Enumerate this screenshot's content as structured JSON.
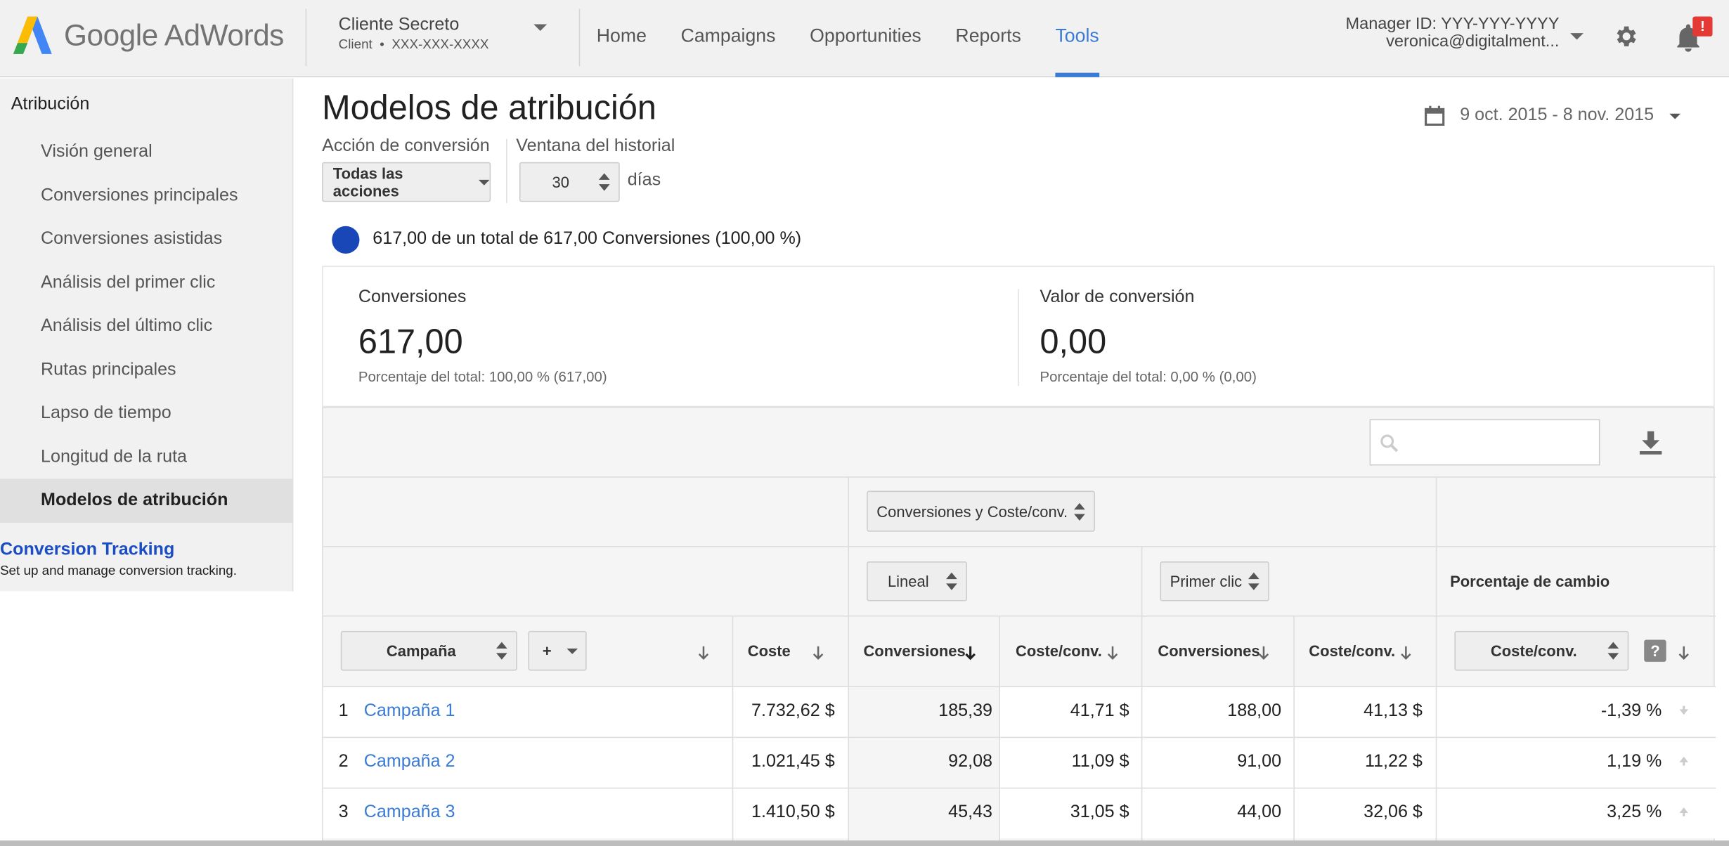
{
  "header": {
    "brand_google": "Google",
    "brand_adwords": "AdWords",
    "account_name": "Cliente Secreto",
    "account_type": "Client",
    "account_id": "XXX-XXX-XXXX",
    "nav": [
      "Home",
      "Campaigns",
      "Opportunities",
      "Reports",
      "Tools"
    ],
    "nav_active": "Tools",
    "manager_id": "Manager ID: YYY-YYY-YYYY",
    "user_email": "veronica@digitalment...",
    "notification_badge": "!",
    "icons": [
      "settings-gear-icon",
      "notification-bell-icon"
    ]
  },
  "sidebar": {
    "title": "Atribución",
    "items": [
      {
        "label": "Visión general"
      },
      {
        "label": "Conversiones principales"
      },
      {
        "label": "Conversiones asistidas"
      },
      {
        "label": "Análisis del primer clic"
      },
      {
        "label": "Análisis del último clic"
      },
      {
        "label": "Rutas principales"
      },
      {
        "label": "Lapso de tiempo"
      },
      {
        "label": "Longitud de la ruta"
      },
      {
        "label": "Modelos de atribución",
        "selected": true
      }
    ],
    "link_title": "Conversion Tracking",
    "link_desc": "Set up and manage conversion tracking."
  },
  "main": {
    "title": "Modelos de atribución",
    "date_range": "9 oct. 2015 - 8 nov. 2015",
    "conversion_action_label": "Acción de conversión",
    "conversion_action_value": "Todas las acciones",
    "window_label": "Ventana del historial",
    "window_value": "30",
    "window_unit": "días",
    "total_text": "617,00 de un total de 617,00 Conversiones (100,00 %)",
    "total_color": "#1a47b8"
  },
  "summary": {
    "conversions_label": "Conversiones",
    "conversions_value": "617,00",
    "conversions_sub": "Porcentaje del total: 100,00 % (617,00)",
    "value_label": "Valor de conversión",
    "value_value": "0,00",
    "value_sub": "Porcentaje del total: 0,00 % (0,00)"
  },
  "table": {
    "metric_select": "Conversiones y Coste/conv.",
    "model_a": "Lineal",
    "model_b": "Primer clic",
    "change_header": "Porcentaje de cambio",
    "campaign_select": "Campaña",
    "add_button": "+",
    "columns": {
      "cost": "Coste",
      "a_conv": "Conversiones",
      "a_cpc": "Coste/conv.",
      "b_conv": "Conversiones",
      "b_cpc": "Coste/conv.",
      "change_select": "Coste/conv.",
      "help": "?"
    },
    "rows": [
      {
        "n": "1",
        "campaign": "Campaña 1",
        "cost": "7.732,62 $",
        "a_conv": "185,39",
        "a_cpc": "41,71 $",
        "b_conv": "188,00",
        "b_cpc": "41,13 $",
        "change": "-1,39 %",
        "trend": "down"
      },
      {
        "n": "2",
        "campaign": "Campaña 2",
        "cost": "1.021,45 $",
        "a_conv": "92,08",
        "a_cpc": "11,09 $",
        "b_conv": "91,00",
        "b_cpc": "11,22 $",
        "change": "1,19 %",
        "trend": "up"
      },
      {
        "n": "3",
        "campaign": "Campaña 3",
        "cost": "1.410,50 $",
        "a_conv": "45,43",
        "a_cpc": "31,05 $",
        "b_conv": "44,00",
        "b_cpc": "32,06 $",
        "change": "3,25 %",
        "trend": "up"
      }
    ]
  },
  "colors": {
    "accent": "#3a7bd5",
    "link": "#1a4cc4",
    "badge": "#e53935"
  }
}
